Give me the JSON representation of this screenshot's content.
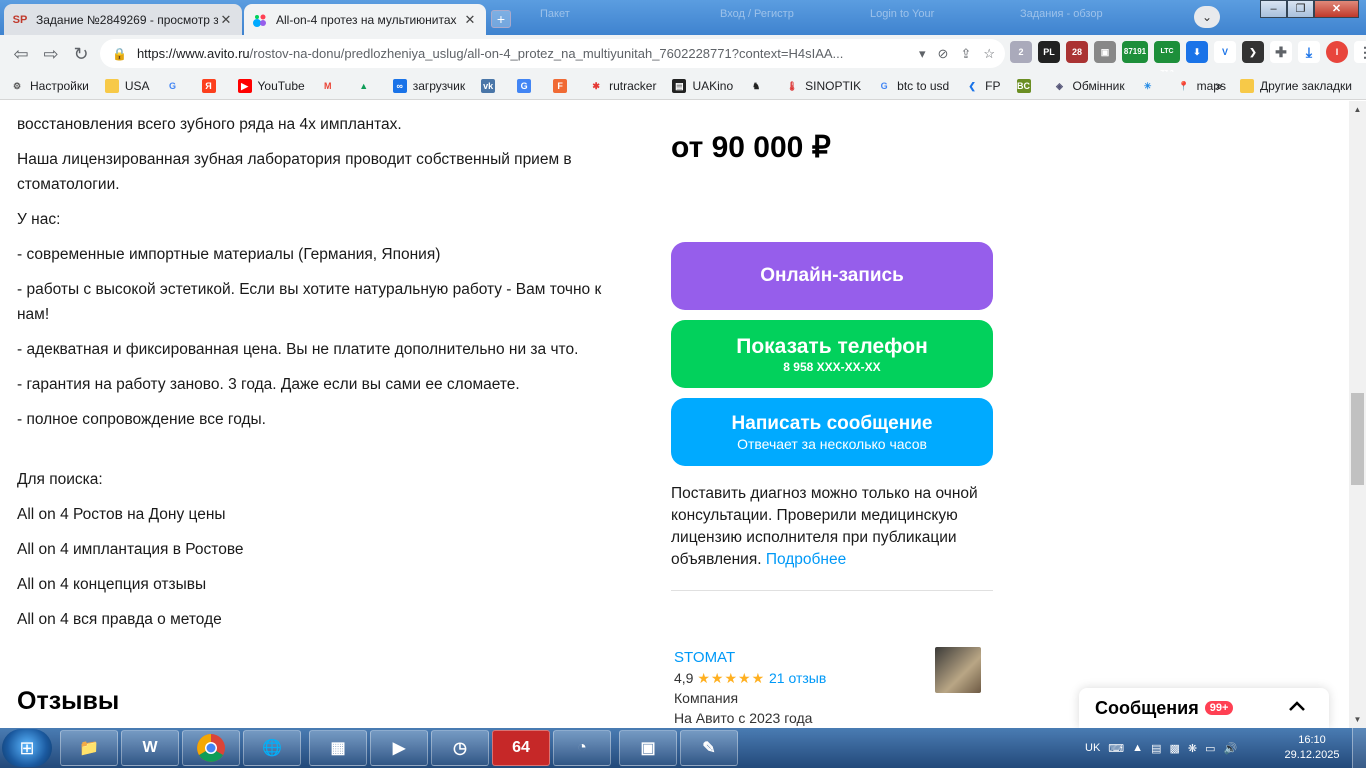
{
  "browser": {
    "tabs": [
      {
        "favicon": "SP",
        "title": "Задание №2849269 - просмотр з"
      },
      {
        "favicon": "avito",
        "title": "All-on-4 протез на мультиюнитах"
      }
    ],
    "ghost_tabs": [
      "Пакет",
      "Вход / Регистр",
      "Login to Your",
      "Задания - обзор"
    ],
    "address": {
      "host": "https://www.avito.ru",
      "path": "/rostov-na-donu/predlozheniya_uslug/all-on-4_protez_na_multiyunitah_7602228771?context=H4sIAA..."
    },
    "extensions": [
      "2",
      "PL",
      "28",
      "87191",
      "LTC 77.3"
    ],
    "bookmarks": [
      "Настройки",
      "USA",
      "",
      "",
      "YouTube",
      "",
      "",
      "загрузчик",
      "",
      "",
      "",
      "rutracker",
      "UAKino",
      "",
      "SINOPTIK",
      "btc to usd",
      "FP",
      "",
      "Обмінник",
      "",
      "maps"
    ],
    "other_bookmarks": "Другие закладки"
  },
  "description": {
    "cut_line": "...",
    "paragraphs": [
      "восстановления всего зубного ряда на 4х имплантах.",
      "Наша лицензированная зубная лаборатория проводит собственный прием в стоматологии.",
      "У нас:",
      "- современные импортные материалы (Германия, Япония)",
      "- работы с высокой эстетикой. Если вы хотите натуральную работу - Вам точно к нам!",
      "- адекватная и фиксированная цена. Вы не платите дополнительно ни за что.",
      "- гарантия на работу заново. 3 года. Даже если вы сами ее сломаете.",
      "- полное сопровождение все годы."
    ],
    "search_heading": "Для поиска:",
    "search_lines": [
      "All on 4 Ростов на Дону цены",
      "All on 4 имплантация в Ростове",
      "All on 4 концепция отзывы",
      "All on 4 вся правда о методе"
    ]
  },
  "reviews_title": "Отзывы",
  "sidebar": {
    "price": "от 90 000 ₽",
    "online_booking": "Онлайн-запись",
    "show_phone": "Показать телефон",
    "phone_masked": "8 958 XXX-XX-XX",
    "write_message": "Написать сообщение",
    "reply_time": "Отвечает за несколько часов",
    "license_text": "Поставить диагноз можно только на очной консультации. Проверили медицинскую лицензию исполнителя при публикации объявления.",
    "license_link": "Подробнее",
    "seller": {
      "name": "STOMAT",
      "rating": "4,9",
      "stars": "★★★★★",
      "reviews": "21 отзыв",
      "type": "Компания",
      "since": "На Авито с 2023 года"
    }
  },
  "messages_widget": {
    "title": "Сообщения",
    "badge": "99+"
  },
  "taskbar": {
    "lang": "UK",
    "time": "16:10",
    "date": "29.12.2025",
    "app_64": "64"
  }
}
